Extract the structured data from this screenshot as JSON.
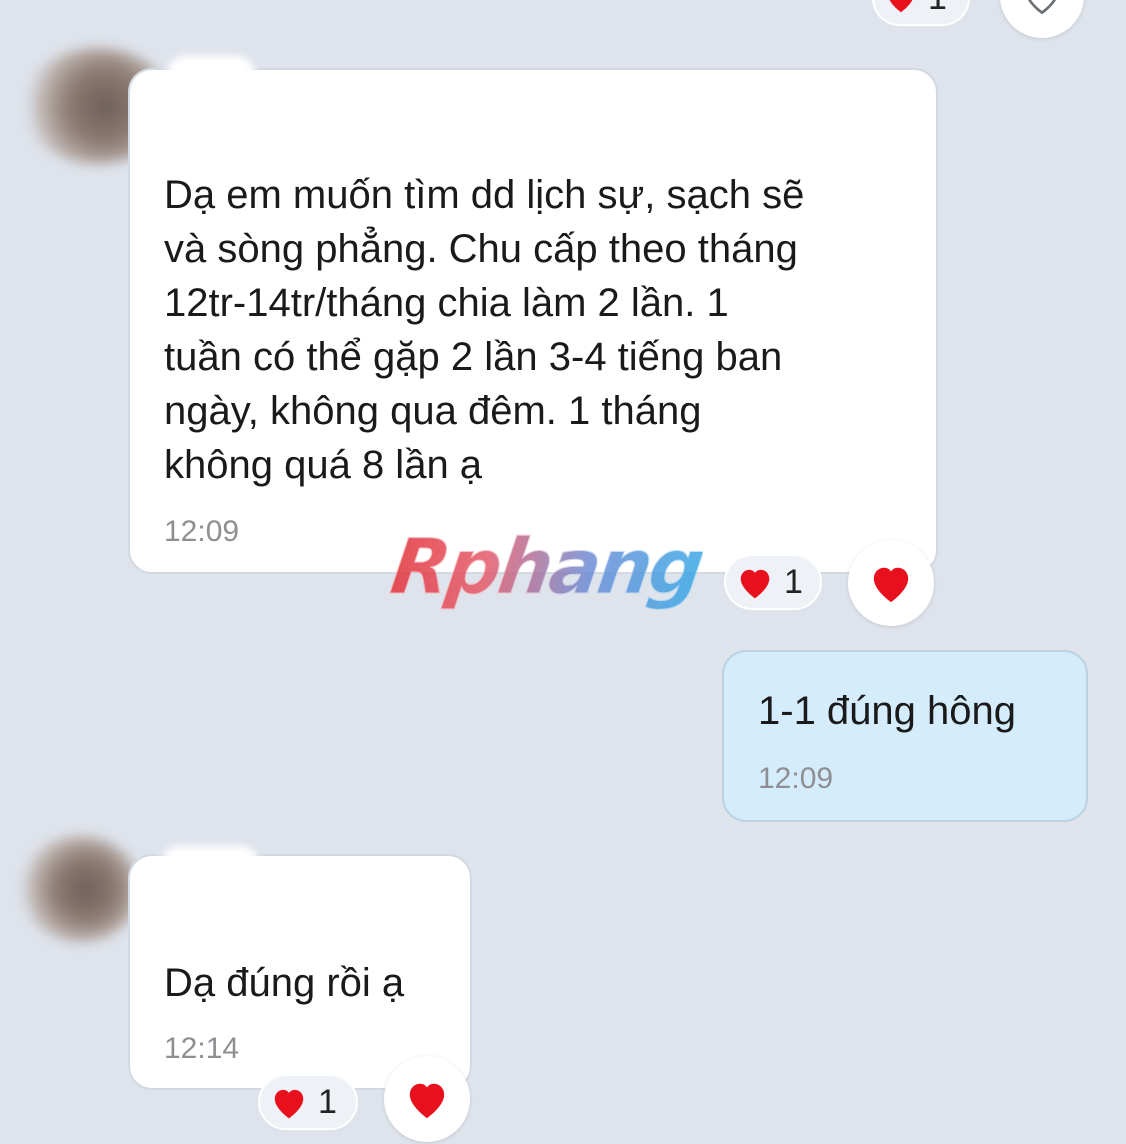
{
  "colors": {
    "background": "#dfe4ec",
    "incoming_bubble": "#ffffff",
    "outgoing_bubble": "#d5ecfc",
    "heart": "#e8101d",
    "time_text": "#8e8f93"
  },
  "watermark": {
    "text": "Rphang"
  },
  "top_partial": {
    "reaction_count": "1",
    "icon": "heart-outline-icon"
  },
  "messages": [
    {
      "sender": "incoming",
      "text": "Dạ em muốn tìm dd lịch sự, sạch sẽ\nvà sòng phẳng. Chu cấp theo tháng\n12tr-14tr/tháng chia làm 2 lần. 1\ntuần có thể gặp 2 lần 3-4 tiếng ban\nngày, không qua đêm. 1 tháng\nkhông quá 8 lần ạ",
      "time": "12:09",
      "reaction_count": "1",
      "reaction_icon": "heart-icon"
    },
    {
      "sender": "outgoing",
      "text": "1-1 đúng hông",
      "time": "12:09"
    },
    {
      "sender": "incoming",
      "text": "Dạ đúng rồi ạ",
      "time": "12:14",
      "reaction_count": "1",
      "reaction_icon": "heart-icon"
    }
  ]
}
